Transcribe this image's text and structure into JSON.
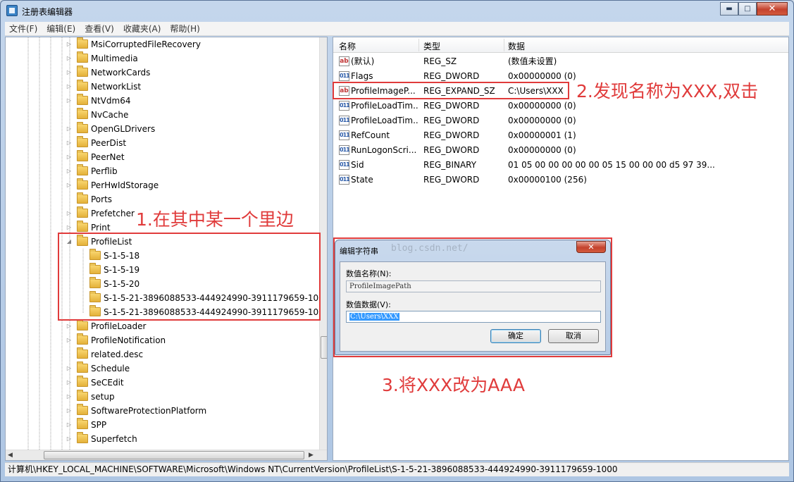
{
  "window": {
    "title": "注册表编辑器",
    "min": "▬",
    "max": "□",
    "close": "✕"
  },
  "menu": [
    "文件(F)",
    "编辑(E)",
    "查看(V)",
    "收藏夹(A)",
    "帮助(H)"
  ],
  "tree": {
    "items": [
      {
        "label": "MsiCorruptedFileRecovery",
        "expander": "▷"
      },
      {
        "label": "Multimedia",
        "expander": "▷"
      },
      {
        "label": "NetworkCards",
        "expander": "▷"
      },
      {
        "label": "NetworkList",
        "expander": "▷"
      },
      {
        "label": "NtVdm64",
        "expander": "▷"
      },
      {
        "label": "NvCache",
        "expander": ""
      },
      {
        "label": "OpenGLDrivers",
        "expander": "▷"
      },
      {
        "label": "PeerDist",
        "expander": "▷"
      },
      {
        "label": "PeerNet",
        "expander": "▷"
      },
      {
        "label": "Perflib",
        "expander": "▷"
      },
      {
        "label": "PerHwIdStorage",
        "expander": "▷"
      },
      {
        "label": "Ports",
        "expander": ""
      },
      {
        "label": "Prefetcher",
        "expander": "▷"
      },
      {
        "label": "Print",
        "expander": "▷"
      },
      {
        "label": "ProfileList",
        "expander": "◢"
      },
      {
        "label": "S-1-5-18",
        "expander": ""
      },
      {
        "label": "S-1-5-19",
        "expander": ""
      },
      {
        "label": "S-1-5-20",
        "expander": ""
      },
      {
        "label": "S-1-5-21-3896088533-444924990-3911179659-1000",
        "expander": ""
      },
      {
        "label": "S-1-5-21-3896088533-444924990-3911179659-1003",
        "expander": ""
      },
      {
        "label": "ProfileLoader",
        "expander": "▷"
      },
      {
        "label": "ProfileNotification",
        "expander": "▷"
      },
      {
        "label": "related.desc",
        "expander": ""
      },
      {
        "label": "Schedule",
        "expander": "▷"
      },
      {
        "label": "SeCEdit",
        "expander": "▷"
      },
      {
        "label": "setup",
        "expander": "▷"
      },
      {
        "label": "SoftwareProtectionPlatform",
        "expander": "▷"
      },
      {
        "label": "SPP",
        "expander": "▷"
      },
      {
        "label": "Superfetch",
        "expander": "▷"
      }
    ],
    "scroll_left": "◀",
    "scroll_right": "▶"
  },
  "list": {
    "headers": {
      "name": "名称",
      "type": "类型",
      "data": "数据"
    },
    "rows": [
      {
        "icon": "ab",
        "name": "(默认)",
        "type": "REG_SZ",
        "data": "(数值未设置)"
      },
      {
        "icon": "011",
        "name": "Flags",
        "type": "REG_DWORD",
        "data": "0x00000000 (0)"
      },
      {
        "icon": "ab",
        "name": "ProfileImageP...",
        "type": "REG_EXPAND_SZ",
        "data": "C:\\Users\\XXX"
      },
      {
        "icon": "011",
        "name": "ProfileLoadTim...",
        "type": "REG_DWORD",
        "data": "0x00000000 (0)"
      },
      {
        "icon": "011",
        "name": "ProfileLoadTim...",
        "type": "REG_DWORD",
        "data": "0x00000000 (0)"
      },
      {
        "icon": "011",
        "name": "RefCount",
        "type": "REG_DWORD",
        "data": "0x00000001 (1)"
      },
      {
        "icon": "011",
        "name": "RunLogonScri...",
        "type": "REG_DWORD",
        "data": "0x00000000 (0)"
      },
      {
        "icon": "011",
        "name": "Sid",
        "type": "REG_BINARY",
        "data": "01 05 00 00 00 00 00 05 15 00 00 00 d5 97 39..."
      },
      {
        "icon": "011",
        "name": "State",
        "type": "REG_DWORD",
        "data": "0x00000100 (256)"
      }
    ]
  },
  "statusbar": "计算机\\HKEY_LOCAL_MACHINE\\SOFTWARE\\Microsoft\\Windows NT\\CurrentVersion\\ProfileList\\S-1-5-21-3896088533-444924990-3911179659-1000",
  "dialog": {
    "title": "编辑字符串",
    "close": "✕",
    "name_label": "数值名称(N):",
    "name_value": "ProfileImagePath",
    "data_label": "数值数据(V):",
    "data_value": "C:\\Users\\XXX",
    "ok": "确定",
    "cancel": "取消"
  },
  "watermark": "blog.csdn.net/",
  "annotations": {
    "step1": "1.在其中某一个里边",
    "step2": "2.发现名称为XXX,双击",
    "step3": "3.将XXX改为AAA",
    "color": "#e03b3b"
  }
}
